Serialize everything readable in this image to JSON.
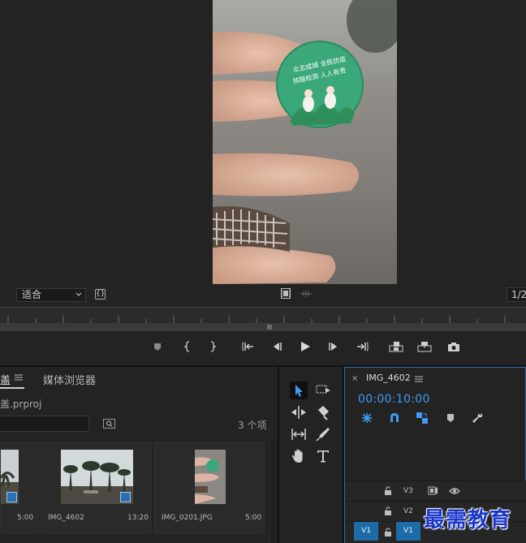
{
  "monitor": {
    "fit_label": "适合",
    "resolution_label": "1/2"
  },
  "project_panel": {
    "tab_label": "盖",
    "media_browser_label": "媒体浏览器",
    "project_file": "盖.prproj",
    "search_placeholder": "",
    "item_count": "3 个项",
    "clips": [
      {
        "name": "",
        "duration": "5:00"
      },
      {
        "name": "IMG_4602",
        "duration": "13:20"
      },
      {
        "name": "IMG_0201.JPG",
        "duration": "5:00"
      }
    ]
  },
  "timeline": {
    "close_label": "×",
    "sequence_name": "IMG_4602",
    "timecode": "00:00:10:00",
    "tracks": [
      {
        "label": "V3"
      },
      {
        "label": "V2"
      },
      {
        "label": "V1"
      }
    ],
    "source_patch_label": "V1",
    "accent_color": "#3e9bf2"
  },
  "watermark": {
    "text": "最需教育"
  },
  "icons": {
    "transport": [
      "marker-icon",
      "mark-in-icon",
      "mark-out-icon",
      "go-to-in-icon",
      "step-back-icon",
      "play-icon",
      "step-forward-icon",
      "go-to-out-icon",
      "insert-icon",
      "overwrite-icon",
      "camera-icon"
    ],
    "tools": [
      "selection-tool-icon",
      "track-select-icon",
      "ripple-edit-icon",
      "razor-icon",
      "slip-icon",
      "pen-icon",
      "hand-icon",
      "type-icon"
    ]
  }
}
